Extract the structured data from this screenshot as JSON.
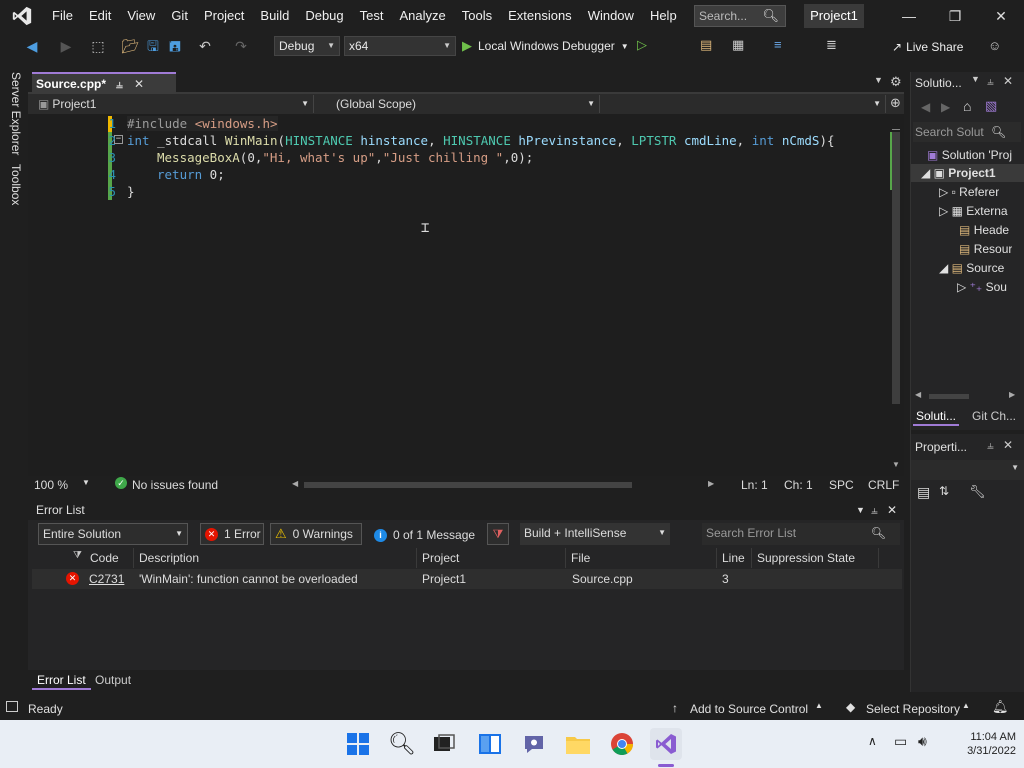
{
  "menu": [
    "File",
    "Edit",
    "View",
    "Git",
    "Project",
    "Build",
    "Debug",
    "Test",
    "Analyze",
    "Tools",
    "Extensions",
    "Window",
    "Help"
  ],
  "search_placeholder": "Search...",
  "window_title": "Project1",
  "toolbar": {
    "config": "Debug",
    "platform": "x64",
    "run_label": "Local Windows Debugger",
    "live_share": "Live Share"
  },
  "side_tabs": [
    "Server Explorer",
    "Toolbox"
  ],
  "doc_tab": "Source.cpp*",
  "nav": {
    "project": "Project1",
    "scope": "(Global Scope)"
  },
  "line_numbers": [
    "1",
    "2",
    "3",
    "4",
    "5"
  ],
  "code": {
    "l1_pp": "#include ",
    "l1_inc": "<windows.h>",
    "l2_kw1": "int",
    "l2_a": " _stdcall ",
    "l2_fn": "WinMain",
    "l2_b": "(",
    "l2_ty1": "HINSTANCE",
    "l2_p1": " hinstance",
    "l2_c": ", ",
    "l2_ty2": "HINSTANCE",
    "l2_p2": " hPrevinstance",
    "l2_d": ", ",
    "l2_ty3": "LPTSTR",
    "l2_p3": " cmdLine",
    "l2_e": ", ",
    "l2_kw2": "int",
    "l2_p4": " nCmdS",
    "l2_f": "){",
    "l3_fn": "MessageBoxA",
    "l3_a": "(0,",
    "l3_s1": "\"Hi, what's up\"",
    "l3_b": ",",
    "l3_s2": "\"Just chilling \"",
    "l3_c": ",0);",
    "l4_kw": "return",
    "l4_a": " 0;",
    "l5": "}"
  },
  "editor_status": {
    "zoom": "100 %",
    "issues": "No issues found",
    "line": "Ln: 1",
    "col": "Ch: 1",
    "spc": "SPC",
    "eol": "CRLF"
  },
  "error_list": {
    "title": "Error List",
    "scope": "Entire Solution",
    "errors": "1 Error",
    "warnings": "0 Warnings",
    "messages": "0 of 1 Message",
    "build_filter": "Build + IntelliSense",
    "search_placeholder": "Search Error List",
    "columns": [
      "Code",
      "Description",
      "Project",
      "File",
      "Line",
      "Suppression State"
    ],
    "rows": [
      {
        "code": "C2731",
        "description": "'WinMain': function cannot be overloaded",
        "project": "Project1",
        "file": "Source.cpp",
        "line": "3",
        "suppression": ""
      }
    ]
  },
  "bottom_tabs": [
    "Error List",
    "Output"
  ],
  "solution_panel": {
    "title": "Solutio...",
    "search_placeholder": "Search Solut",
    "tree": [
      "Solution 'Proj",
      "Project1",
      "Referer",
      "Externa",
      "Heade",
      "Resour",
      "Source",
      "Sou"
    ],
    "tabs": [
      "Soluti...",
      "Git Ch..."
    ]
  },
  "properties_panel": {
    "title": "Properti..."
  },
  "statusbar": {
    "ready": "Ready",
    "source_control": "Add to Source Control",
    "repo": "Select Repository"
  },
  "taskbar": {
    "time": "11:04 AM",
    "date": "3/31/2022"
  },
  "colors": {
    "accent": "#a07bd6",
    "error": "#e51400",
    "run": "#6fbf4a"
  }
}
